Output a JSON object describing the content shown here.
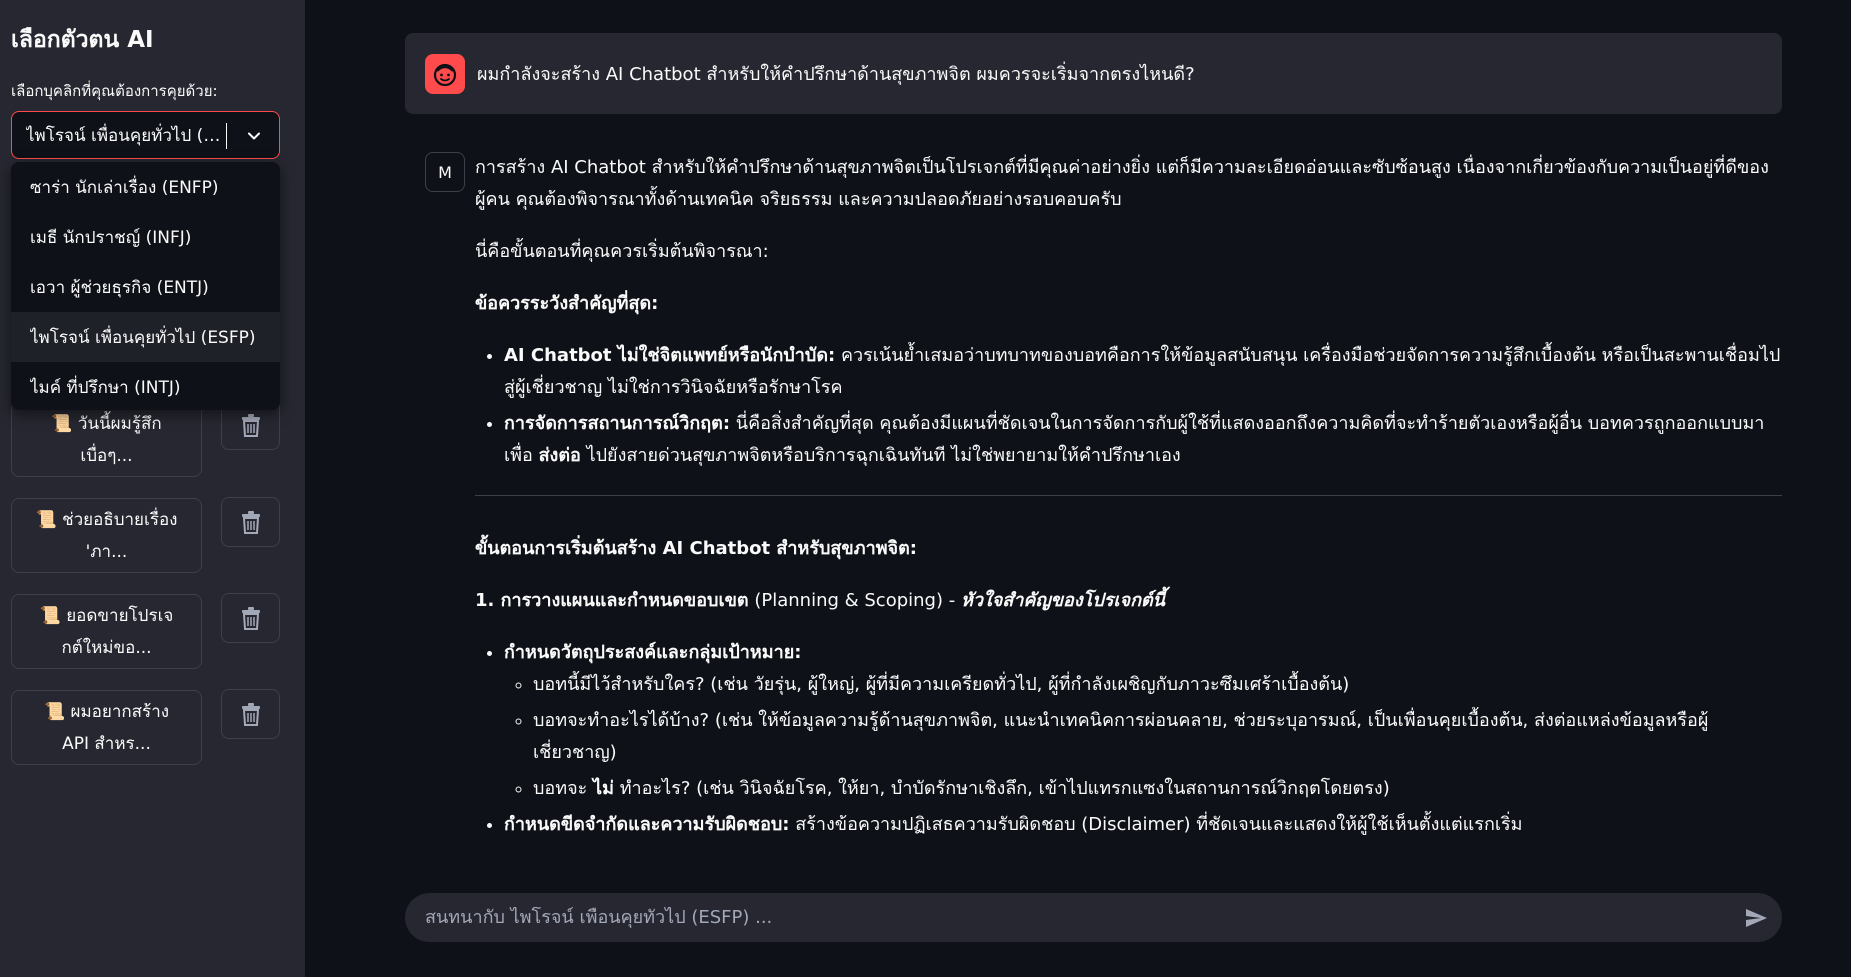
{
  "sidebar": {
    "title": "เลือกตัวตน AI",
    "select_label": "เลือกบุคลิกที่คุณต้องการคุยด้วย:",
    "selected_value": "ไพโรจน์ เพื่อนคุยทั่วไป (ESFP)",
    "options": [
      "ซาร่า นักเล่าเรื่อง (ENFP)",
      "เมธี นักปราชญ์ (INFJ)",
      "เอวา ผู้ช่วยธุรกิจ (ENTJ)",
      "ไพโรจน์ เพื่อนคุยทั่วไป (ESFP)",
      "ไมค์ ที่ปรึกษา (INTJ)"
    ],
    "history": [
      {
        "line1": "📜 วันนี้ผมรู้สึก",
        "line2": "เบื่อๆ..."
      },
      {
        "line1": "📜 ช่วยอธิบายเรื่อง",
        "line2": "'ภา..."
      },
      {
        "line1": "📜 ยอดขายโปรเจ",
        "line2": "กต์ใหม่ขอ..."
      },
      {
        "line1": "📜 ผมอยากสร้าง",
        "line2": "API สำหร..."
      }
    ]
  },
  "chat": {
    "user_message": "ผมกำลังจะสร้าง AI Chatbot สำหรับให้คำปรึกษาด้านสุขภาพจิต ผมควรจะเริ่มจากตรงไหนดี?",
    "bot_avatar": "M",
    "intro": "การสร้าง AI Chatbot สำหรับให้คำปรึกษาด้านสุขภาพจิตเป็นโปรเจกต์ที่มีคุณค่าอย่างยิ่ง แต่ก็มีความละเอียดอ่อนและซับซ้อนสูง เนื่องจากเกี่ยวข้องกับความเป็นอยู่ที่ดีของผู้คน คุณต้องพิจารณาทั้งด้านเทคนิค จริยธรรม และความปลอดภัยอย่างรอบคอบครับ",
    "steps_lead": "นี่คือขั้นตอนที่คุณควรเริ่มต้นพิจารณา:",
    "warning_heading": "ข้อควรระวังสำคัญที่สุด:",
    "warning1_bold": "AI Chatbot ไม่ใช่จิตแพทย์หรือนักบำบัด:",
    "warning1_text": " ควรเน้นย้ำเสมอว่าบทบาทของบอทคือการให้ข้อมูลสนับสนุน เครื่องมือช่วยจัดการความรู้สึกเบื้องต้น หรือเป็นสะพานเชื่อมไปสู่ผู้เชี่ยวชาญ ไม่ใช่การวินิจฉัยหรือรักษาโรค",
    "warning2_bold": "การจัดการสถานการณ์วิกฤต:",
    "warning2_text_a": " นี่คือสิ่งสำคัญที่สุด คุณต้องมีแผนที่ชัดเจนในการจัดการกับผู้ใช้ที่แสดงออกถึงความคิดที่จะทำร้ายตัวเองหรือผู้อื่น บอทควรถูกออกแบบมาเพื่อ ",
    "warning2_bold2": "ส่งต่อ",
    "warning2_text_b": " ไปยังสายด่วนสุขภาพจิตหรือบริการฉุกเฉินทันที ไม่ใช่พยายามให้คำปรึกษาเอง",
    "start_heading": "ขั้นตอนการเริ่มต้นสร้าง AI Chatbot สำหรับสุขภาพจิต:",
    "step1_bold": "1. การวางแผนและกำหนดขอบเขต",
    "step1_plain": " (Planning & Scoping) - ",
    "step1_italic": "หัวใจสำคัญของโปรเจกต์นี้",
    "goal_bold": "กำหนดวัตถุประสงค์และกลุ่มเป้าหมาย:",
    "goal_sub1": "บอทนี้มีไว้สำหรับใคร? (เช่น วัยรุ่น, ผู้ใหญ่, ผู้ที่มีความเครียดทั่วไป, ผู้ที่กำลังเผชิญกับภาวะซึมเศร้าเบื้องต้น)",
    "goal_sub2": "บอทจะทำอะไรได้บ้าง? (เช่น ให้ข้อมูลความรู้ด้านสุขภาพจิต, แนะนำเทคนิคการผ่อนคลาย, ช่วยระบุอารมณ์, เป็นเพื่อนคุยเบื้องต้น, ส่งต่อแหล่งข้อมูลหรือผู้เชี่ยวชาญ)",
    "goal_sub3_a": "บอทจะ ",
    "goal_sub3_bold": "ไม่",
    "goal_sub3_b": " ทำอะไร? (เช่น วินิจฉัยโรค, ให้ยา, บำบัดรักษาเชิงลึก, เข้าไปแทรกแซงในสถานการณ์วิกฤตโดยตรง)",
    "limit_bold": "กำหนดขีดจำกัดและความรับผิดชอบ:",
    "limit_text": " สร้างข้อความปฏิเสธความรับผิดชอบ (Disclaimer) ที่ชัดเจนและแสดงให้ผู้ใช้เห็นตั้งแต่แรกเริ่ม"
  },
  "input": {
    "placeholder": "สนทนากับ ไพโรจน์ เพื่อนคุยทั่วไป (ESFP) ..."
  },
  "colors": {
    "background": "#0e1117",
    "sidebar": "#262730",
    "accent": "#ff4b4b"
  }
}
